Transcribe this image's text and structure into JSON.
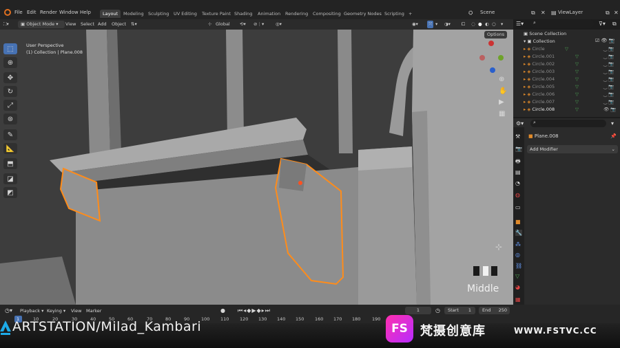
{
  "menu": [
    "File",
    "Edit",
    "Render",
    "Window",
    "Help"
  ],
  "workspaces": [
    "Layout",
    "Modeling",
    "Sculpting",
    "UV Editing",
    "Texture Paint",
    "Shading",
    "Animation",
    "Rendering",
    "Compositing",
    "Geometry Nodes",
    "Scripting",
    "+"
  ],
  "active_workspace": "Layout",
  "scene": "Scene",
  "view_layer": "ViewLayer",
  "header": {
    "mode": "Object Mode",
    "view": "View",
    "select": "Select",
    "add": "Add",
    "object": "Object",
    "transform": "Global",
    "options": "Options"
  },
  "viewport": {
    "perspective": "User Perspective",
    "collection_info": "(1) Collection | Plane.008",
    "key_hint": "Middle"
  },
  "outliner": {
    "root": "Scene Collection",
    "collection": "Collection",
    "items": [
      "Circle",
      "Circle.001",
      "Circle.002",
      "Circle.003",
      "Circle.004",
      "Circle.005",
      "Circle.006",
      "Circle.007",
      "Circle.008"
    ]
  },
  "properties": {
    "object_name": "Plane.008",
    "add_modifier": "Add Modifier"
  },
  "timeline": {
    "playback": "Playback",
    "keying": "Keying",
    "view": "View",
    "marker": "Marker",
    "current_frame": "1",
    "start_label": "Start",
    "start": "1",
    "end_label": "End",
    "end": "250",
    "ticks": [
      "1",
      "10",
      "20",
      "30",
      "40",
      "50",
      "60",
      "70",
      "80",
      "90",
      "100",
      "110",
      "120",
      "130",
      "140",
      "150",
      "160",
      "170",
      "180",
      "190"
    ]
  },
  "watermark": {
    "artstation": "ARTSTATION/Milad_Kambari",
    "fs": "FS",
    "chinese": "梵摄创意库",
    "url": "WWW.FSTVC.CC"
  },
  "colors": {
    "accent_blue": "#4772b3",
    "selection_orange": "#ff8c1a",
    "mesh_grey": "#8e8e8e",
    "fs_pink": "#ff2fae"
  }
}
